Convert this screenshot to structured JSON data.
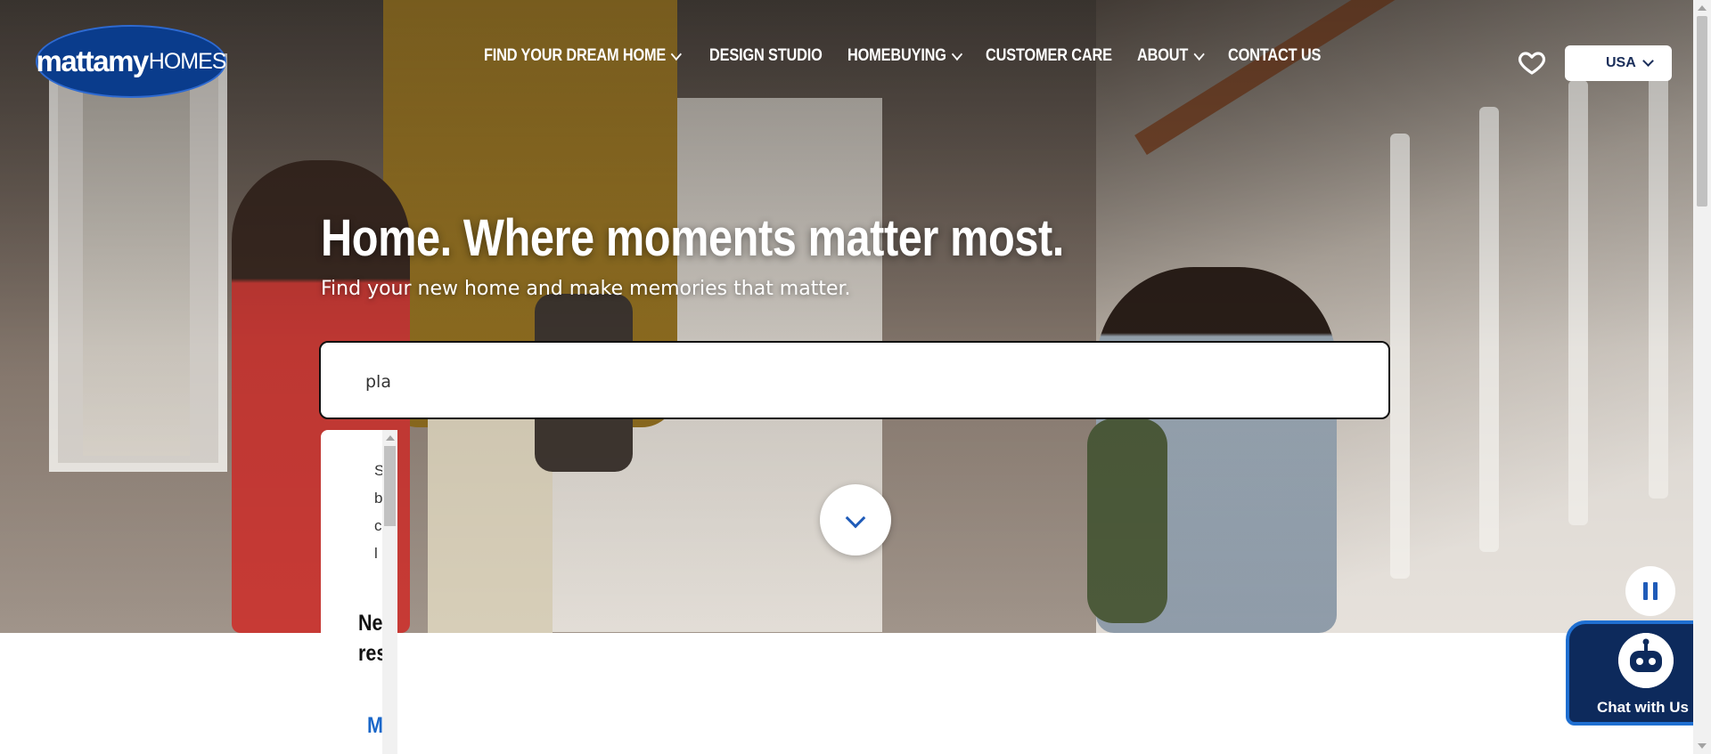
{
  "header": {
    "logo": {
      "brand": "mattamy",
      "brand_suffix": "HOMES"
    },
    "nav": [
      {
        "label": "FIND YOUR DREAM HOME",
        "has_dropdown": true
      },
      {
        "label": "DESIGN STUDIO",
        "has_dropdown": false
      },
      {
        "label": "HOMEBUYING",
        "has_dropdown": true
      },
      {
        "label": "CUSTOMER CARE",
        "has_dropdown": false
      },
      {
        "label": "ABOUT",
        "has_dropdown": true
      },
      {
        "label": "CONTACT US",
        "has_dropdown": false
      }
    ],
    "favorites_icon": "heart-icon",
    "country_select": {
      "value": "USA"
    }
  },
  "hero": {
    "headline": "Home. Where moments matter most.",
    "subhead": "Find your new home and make memories that matter.",
    "search": {
      "value": "pla",
      "placeholder": ""
    }
  },
  "search_dropdown": {
    "list_fragments": [
      "S",
      "b",
      "c",
      "l"
    ],
    "heading": "Ne\nres",
    "link": "M"
  },
  "controls": {
    "scroll_down_icon": "chevron-down-icon",
    "pause_icon": "pause-icon"
  },
  "chat": {
    "label": "Chat with Us"
  },
  "colors": {
    "brand_blue": "#0a3c8c",
    "accent_blue": "#1f5bb8",
    "chat_bg": "#0d2a5c",
    "link_blue": "#1a67c9"
  }
}
